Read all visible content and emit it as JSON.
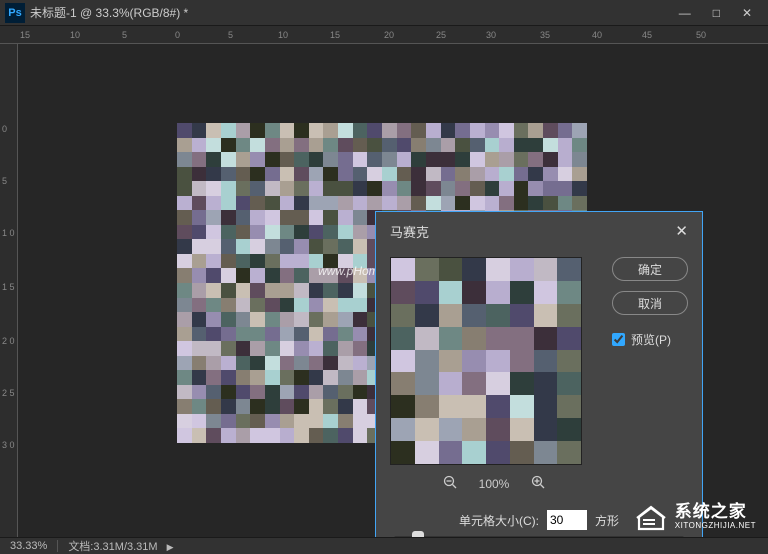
{
  "window": {
    "app_icon_text": "Ps",
    "title": "未标题-1 @ 33.3%(RGB/8#) *",
    "minimize": "—",
    "maximize": "□",
    "close": "✕"
  },
  "ruler_top": [
    "15",
    "10",
    "5",
    "0",
    "5",
    "10",
    "15",
    "20",
    "25",
    "30",
    "35",
    "40",
    "45",
    "50"
  ],
  "ruler_left": [
    "0",
    "5",
    "1 0",
    "1 5",
    "2 0",
    "2 5",
    "3 0"
  ],
  "dialog": {
    "title": "马赛克",
    "close": "✕",
    "ok_label": "确定",
    "cancel_label": "取消",
    "preview_label": "预览(P)",
    "preview_checked": true,
    "zoom_out_icon": "zoom-out",
    "zoom_pct": "100%",
    "zoom_in_icon": "zoom-in",
    "cell_label": "单元格大小(C):",
    "cell_value": "30",
    "cell_unit": "方形"
  },
  "watermark": "www.pHome.NET",
  "status": {
    "zoom": "33.33%",
    "docinfo_label": "文档:",
    "docinfo_value": "3.31M/3.31M"
  },
  "brand": {
    "cn": "系统之家",
    "en": "XITONGZHIJIA.NET"
  },
  "colors": {
    "accent_border": "#42a5f5",
    "dialog_bg": "#454545"
  },
  "chart_data": null
}
